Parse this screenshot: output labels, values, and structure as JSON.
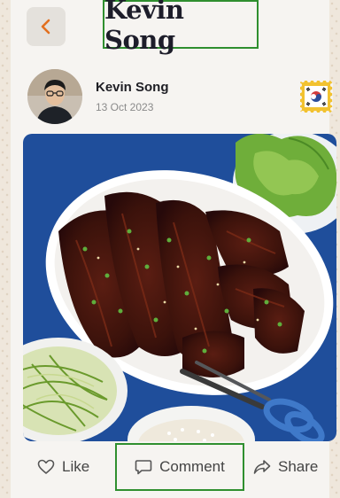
{
  "header": {
    "title": "Kevin Song",
    "back_icon": "chevron-left-icon"
  },
  "post": {
    "author": "Kevin Song",
    "date": "13 Oct 2023",
    "badge_icon": "south-korea-flag-icon",
    "image": "grilled-galbi-ribs-photo"
  },
  "actions": {
    "like_label": "Like",
    "comment_label": "Comment",
    "share_label": "Share"
  },
  "colors": {
    "background": "#f6f4f1",
    "back_button": "#e4e1dc",
    "back_arrow": "#e2701f",
    "title_text": "#1d1d2a",
    "highlight_border": "#2f8f2f",
    "plate_blue": "#1f4e9b"
  }
}
